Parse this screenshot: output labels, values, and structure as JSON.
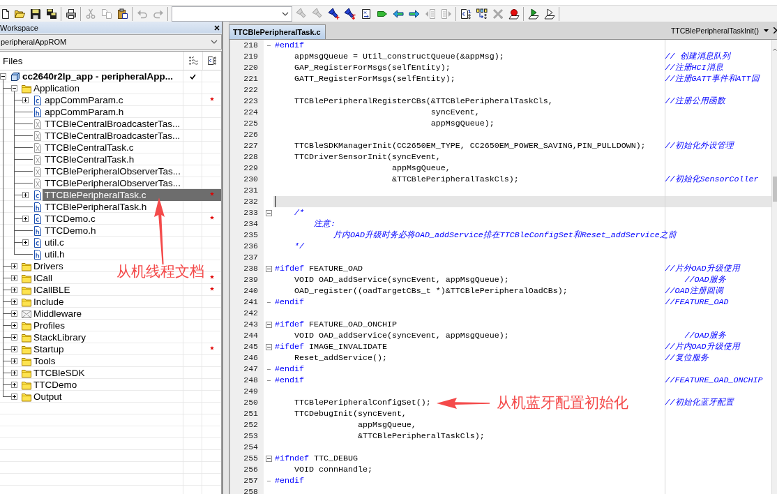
{
  "toolbar": [
    {
      "kind": "new-file",
      "disabled": false
    },
    {
      "kind": "open",
      "disabled": false
    },
    {
      "kind": "save",
      "disabled": false
    },
    {
      "kind": "save-all",
      "disabled": false
    },
    {
      "kind": "separator"
    },
    {
      "kind": "print",
      "disabled": false
    },
    {
      "kind": "separator"
    },
    {
      "kind": "cut",
      "disabled": true
    },
    {
      "kind": "copy",
      "disabled": true
    },
    {
      "kind": "paste",
      "disabled": false
    },
    {
      "kind": "separator"
    },
    {
      "kind": "undo",
      "disabled": true
    },
    {
      "kind": "redo",
      "disabled": true
    },
    {
      "kind": "separator"
    },
    {
      "kind": "combo"
    },
    {
      "kind": "find",
      "disabled": true
    },
    {
      "kind": "find",
      "disabled": true
    },
    {
      "kind": "find-plus",
      "disabled": false
    },
    {
      "kind": "find-arrow",
      "disabled": false
    },
    {
      "kind": "doc-arrows",
      "disabled": false
    },
    {
      "kind": "tag",
      "disabled": false
    },
    {
      "kind": "nav-back",
      "disabled": false
    },
    {
      "kind": "nav-forward",
      "disabled": false
    },
    {
      "kind": "page-back",
      "disabled": true
    },
    {
      "kind": "page-forward",
      "disabled": true
    },
    {
      "kind": "separator"
    },
    {
      "kind": "compile",
      "disabled": false
    },
    {
      "kind": "make",
      "disabled": false
    },
    {
      "kind": "stop",
      "disabled": true
    },
    {
      "kind": "breakpoint",
      "disabled": false
    },
    {
      "kind": "separator"
    },
    {
      "kind": "debug",
      "disabled": false
    },
    {
      "kind": "debug-outline",
      "disabled": false
    },
    {
      "kind": "separator"
    }
  ],
  "workspace": {
    "title": "Workspace",
    "configuration": "peripheralAppROM",
    "column": "Files",
    "tree": [
      {
        "label": "cc2640r2lp_app - peripheralApp...",
        "kind": "project",
        "expanded": true,
        "selected": false,
        "checked": true,
        "marked": false,
        "children": [
          {
            "label": "Application",
            "kind": "folder",
            "expanded": true,
            "selected": false,
            "checked": false,
            "marked": false,
            "children": [
              {
                "label": "appCommParam.c",
                "kind": "c-file",
                "expanded": false,
                "selected": false,
                "checked": false,
                "marked": true
              },
              {
                "label": "appCommParam.h",
                "kind": "h-file",
                "selected": false,
                "checked": false,
                "marked": false
              },
              {
                "label": "TTCBleCentralBroadcasterTas...",
                "kind": "excluded-file",
                "selected": false,
                "checked": false,
                "marked": false
              },
              {
                "label": "TTCBleCentralBroadcasterTas...",
                "kind": "excluded-file",
                "selected": false,
                "checked": false,
                "marked": false
              },
              {
                "label": "TTCBleCentralTask.c",
                "kind": "excluded-file",
                "selected": false,
                "checked": false,
                "marked": false
              },
              {
                "label": "TTCBleCentralTask.h",
                "kind": "excluded-file",
                "selected": false,
                "checked": false,
                "marked": false
              },
              {
                "label": "TTCBlePeripheralObserverTas...",
                "kind": "excluded-file",
                "selected": false,
                "checked": false,
                "marked": false
              },
              {
                "label": "TTCBlePeripheralObserverTas...",
                "kind": "excluded-file",
                "selected": false,
                "checked": false,
                "marked": false
              },
              {
                "label": "TTCBlePeripheralTask.c",
                "kind": "c-file",
                "expanded": false,
                "selected": true,
                "checked": false,
                "marked": true
              },
              {
                "label": "TTCBlePeripheralTask.h",
                "kind": "h-file",
                "selected": false,
                "checked": false,
                "marked": false
              },
              {
                "label": "TTCDemo.c",
                "kind": "c-file",
                "expanded": false,
                "selected": false,
                "checked": false,
                "marked": true
              },
              {
                "label": "TTCDemo.h",
                "kind": "h-file",
                "selected": false,
                "checked": false,
                "marked": false
              },
              {
                "label": "util.c",
                "kind": "c-file",
                "expanded": false,
                "selected": false,
                "checked": false,
                "marked": false
              },
              {
                "label": "util.h",
                "kind": "h-file",
                "selected": false,
                "checked": false,
                "marked": false
              }
            ]
          },
          {
            "label": "Drivers",
            "kind": "folder",
            "expanded": false,
            "selected": false,
            "checked": false,
            "marked": false
          },
          {
            "label": "ICall",
            "kind": "folder",
            "expanded": false,
            "selected": false,
            "checked": false,
            "marked": true
          },
          {
            "label": "ICallBLE",
            "kind": "folder",
            "expanded": false,
            "selected": false,
            "checked": false,
            "marked": true
          },
          {
            "label": "Include",
            "kind": "folder",
            "expanded": false,
            "selected": false,
            "checked": false,
            "marked": false
          },
          {
            "label": "Middleware",
            "kind": "excluded-folder",
            "expanded": false,
            "selected": false,
            "checked": false,
            "marked": false
          },
          {
            "label": "Profiles",
            "kind": "folder",
            "expanded": false,
            "selected": false,
            "checked": false,
            "marked": false
          },
          {
            "label": "StackLibrary",
            "kind": "folder",
            "expanded": false,
            "selected": false,
            "checked": false,
            "marked": false
          },
          {
            "label": "Startup",
            "kind": "folder",
            "expanded": false,
            "selected": false,
            "checked": false,
            "marked": true
          },
          {
            "label": "Tools",
            "kind": "folder",
            "expanded": false,
            "selected": false,
            "checked": false,
            "marked": false
          },
          {
            "label": "TTCBleSDK",
            "kind": "folder",
            "expanded": false,
            "selected": false,
            "checked": false,
            "marked": false
          },
          {
            "label": "TTCDemo",
            "kind": "folder",
            "expanded": false,
            "selected": false,
            "checked": false,
            "marked": false
          },
          {
            "label": "Output",
            "kind": "folder",
            "expanded": false,
            "selected": false,
            "checked": false,
            "marked": false
          }
        ]
      }
    ]
  },
  "editor": {
    "tabs": [
      {
        "label": "TTCBlePeripheralTask.c",
        "selected": true
      }
    ],
    "function": "TTCBlePeripheralTaskInit()",
    "lines": [
      {
        "n": "218",
        "kind": "directive",
        "keyword": "#endif",
        "fold_end": true,
        "current": false
      },
      {
        "n": "219",
        "kind": "code",
        "text": "    appMsgQueue = Util_constructQueue(&appMsg);",
        "note": "// 创建消息队列",
        "current": false
      },
      {
        "n": "220",
        "kind": "code",
        "text": "    GAP_RegisterForMsgs(selfEntity);",
        "note": "//注册HCI消息",
        "current": false
      },
      {
        "n": "221",
        "kind": "code",
        "text": "    GATT_RegisterForMsgs(selfEntity);",
        "note": "//注册GATT事件和ATT回",
        "current": false
      },
      {
        "n": "222",
        "kind": "code",
        "current": false
      },
      {
        "n": "223",
        "kind": "code",
        "text": "    TTCBlePeripheralRegisterCBs(&TTCBlePeripheralTaskCls,",
        "note": "//注册公用函数",
        "current": false
      },
      {
        "n": "224",
        "kind": "code",
        "text": "                                syncEvent,",
        "current": false
      },
      {
        "n": "225",
        "kind": "code",
        "text": "                                appMsgQueue);",
        "current": false
      },
      {
        "n": "226",
        "kind": "code",
        "current": false
      },
      {
        "n": "227",
        "kind": "code",
        "text": "    TTCBleSDKManagerInit(CC2650EM_TYPE, CC2650EM_POWER_SAVING,PIN_PULLDOWN);",
        "note": "//初始化外设管理",
        "current": false
      },
      {
        "n": "228",
        "kind": "code",
        "text": "    TTCDriverSensorInit(syncEvent,",
        "current": false
      },
      {
        "n": "229",
        "kind": "code",
        "text": "                        appMsgQueue,",
        "current": false
      },
      {
        "n": "230",
        "kind": "code",
        "text": "                        &TTCBlePeripheralTaskCls);",
        "note": "//初始化SensorColler",
        "current": false
      },
      {
        "n": "231",
        "kind": "code",
        "current": false
      },
      {
        "n": "232",
        "kind": "code",
        "current": true
      },
      {
        "n": "233",
        "kind": "comment",
        "text": "    /*",
        "expanded": true,
        "current": false
      },
      {
        "n": "234",
        "kind": "comment",
        "text": "        注意:",
        "current": false
      },
      {
        "n": "235",
        "kind": "comment",
        "text": "            片内OAD升级时务必将OAD_addService排在TTCBleConfigSet和Reset_addService之前",
        "current": false
      },
      {
        "n": "236",
        "kind": "comment",
        "text": "    */",
        "current": false
      },
      {
        "n": "237",
        "kind": "code",
        "current": false
      },
      {
        "n": "238",
        "kind": "directive",
        "keyword": "#ifdef",
        "text": "FEATURE_OAD",
        "note": "//片外OAD升级使用",
        "expanded": true,
        "current": false
      },
      {
        "n": "239",
        "kind": "code",
        "text": "    VOID OAD_addService(syncEvent, appMsgQueue);",
        "note": "    //OAD服务",
        "current": false
      },
      {
        "n": "240",
        "kind": "code",
        "text": "    OAD_register((oadTargetCBs_t *)&TTCBlePeripheralOadCBs);",
        "note": "//OAD注册回调",
        "current": false
      },
      {
        "n": "241",
        "kind": "directive",
        "keyword": "#endif",
        "note": "//FEATURE_OAD",
        "fold_end": true,
        "current": false
      },
      {
        "n": "242",
        "kind": "code",
        "current": false
      },
      {
        "n": "243",
        "kind": "directive",
        "keyword": "#ifdef",
        "text": "FEATURE_OAD_ONCHIP",
        "expanded": true,
        "current": false
      },
      {
        "n": "244",
        "kind": "code",
        "text": "    VOID OAD_addService(syncEvent, appMsgQueue);",
        "note": "    //OAD服务",
        "current": false
      },
      {
        "n": "245",
        "kind": "directive",
        "keyword": "#ifdef",
        "text": "IMAGE_INVALIDATE",
        "note": "//片内OAD升级使用",
        "expanded": true,
        "current": false
      },
      {
        "n": "246",
        "kind": "code",
        "text": "    Reset_addService();",
        "note": "//复位服务",
        "current": false
      },
      {
        "n": "247",
        "kind": "directive",
        "keyword": "#endif",
        "fold_end": true,
        "current": false
      },
      {
        "n": "248",
        "kind": "directive",
        "keyword": "#endif",
        "note": "//FEATURE_OAD_ONCHIP",
        "fold_end": true,
        "current": false
      },
      {
        "n": "249",
        "kind": "code",
        "current": false
      },
      {
        "n": "250",
        "kind": "code",
        "text": "    TTCBlePeripheralConfigSet();",
        "note": "//初始化蓝牙配置",
        "current": false
      },
      {
        "n": "251",
        "kind": "code",
        "text": "    TTCDebugInit(syncEvent,",
        "current": false
      },
      {
        "n": "252",
        "kind": "code",
        "text": "                 appMsgQueue,",
        "current": false
      },
      {
        "n": "253",
        "kind": "code",
        "text": "                 &TTCBlePeripheralTaskCls);",
        "current": false
      },
      {
        "n": "254",
        "kind": "code",
        "current": false
      },
      {
        "n": "255",
        "kind": "directive",
        "keyword": "#ifndef",
        "text": "TTC_DEBUG",
        "expanded": true,
        "current": false
      },
      {
        "n": "256",
        "kind": "code",
        "text": "    VOID connHandle;",
        "current": false
      },
      {
        "n": "257",
        "kind": "directive",
        "keyword": "#endif",
        "fold_end": true,
        "current": false
      },
      {
        "n": "258",
        "kind": "code",
        "current": false
      }
    ]
  },
  "annotations": [
    {
      "text": "从机线程文档"
    },
    {
      "text": "从机蓝牙配置初始化"
    }
  ]
}
